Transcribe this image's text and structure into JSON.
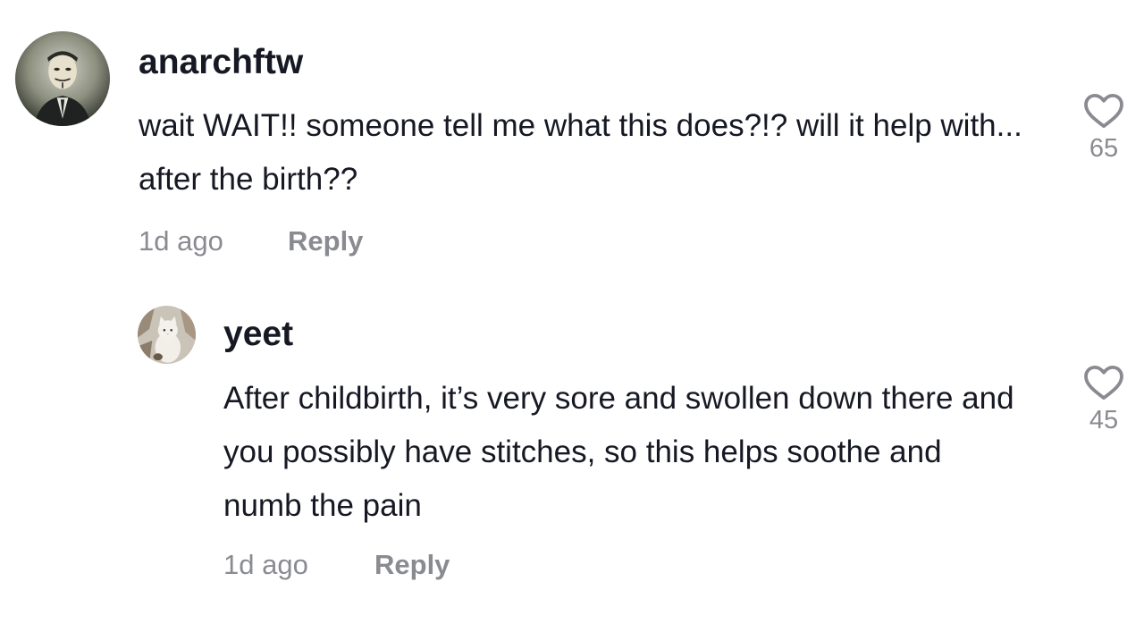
{
  "comments": [
    {
      "username": "anarchftw",
      "avatar_icon": "masked-user-avatar",
      "text": "wait WAIT!! someone tell me what this does?!? will it help with... after the birth??",
      "time": "1d ago",
      "reply_label": "Reply",
      "like_count": "65"
    },
    {
      "username": "yeet",
      "avatar_icon": "cat-avatar",
      "text": "After childbirth, it’s very sore and swollen down there and you possibly have stitches, so this helps soothe and numb the pain",
      "time": "1d ago",
      "reply_label": "Reply",
      "like_count": "45"
    }
  ],
  "colors": {
    "text": "#161823",
    "secondary": "#8a8b91",
    "heart_outline": "#8a8b91"
  }
}
